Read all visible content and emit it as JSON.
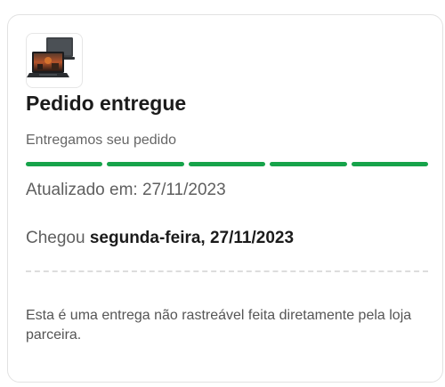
{
  "order": {
    "product_image_name": "laptop-image",
    "title": "Pedido entregue",
    "subtitle": "Entregamos seu pedido",
    "progress": {
      "completed_steps": 5,
      "total_steps": 5,
      "color": "#16a34a"
    },
    "updated_label": "Atualizado em:",
    "updated_date": "27/11/2023",
    "arrived_label": "Chegou",
    "arrived_date": "segunda-feira, 27/11/2023",
    "note": "Esta é uma entrega não rastreável feita diretamente pela loja parceira."
  }
}
